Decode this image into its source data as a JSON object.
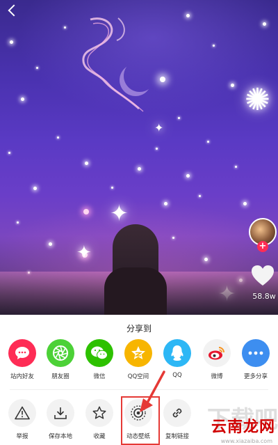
{
  "video": {
    "like_count": "58.8w",
    "follow_badge": "+"
  },
  "share_sheet": {
    "title": "分享到",
    "row1": [
      {
        "label": "站内好友",
        "icon": "message-bubble-icon",
        "color": "#fe2c55"
      },
      {
        "label": "朋友圈",
        "icon": "moments-aperture-icon",
        "color": "#4cd137"
      },
      {
        "label": "微信",
        "icon": "wechat-icon",
        "color": "#2dc100"
      },
      {
        "label": "QQ空间",
        "icon": "qzone-star-icon",
        "color": "#f7b500"
      },
      {
        "label": "QQ",
        "icon": "qq-penguin-icon",
        "color": "#2db7f5"
      },
      {
        "label": "微博",
        "icon": "weibo-icon",
        "color": "#f2f2f2"
      },
      {
        "label": "更多分享",
        "icon": "more-dots-icon",
        "color": "#3d8ef0"
      }
    ],
    "row2": [
      {
        "label": "举报",
        "icon": "warning-icon"
      },
      {
        "label": "保存本地",
        "icon": "download-icon"
      },
      {
        "label": "收藏",
        "icon": "star-icon"
      },
      {
        "label": "动态壁纸",
        "icon": "live-wallpaper-icon"
      },
      {
        "label": "复制链接",
        "icon": "link-icon"
      }
    ]
  },
  "watermark": {
    "site_name": "云南龙网",
    "url": "www.xiazaiba.com",
    "bg_text": "下载吧"
  }
}
